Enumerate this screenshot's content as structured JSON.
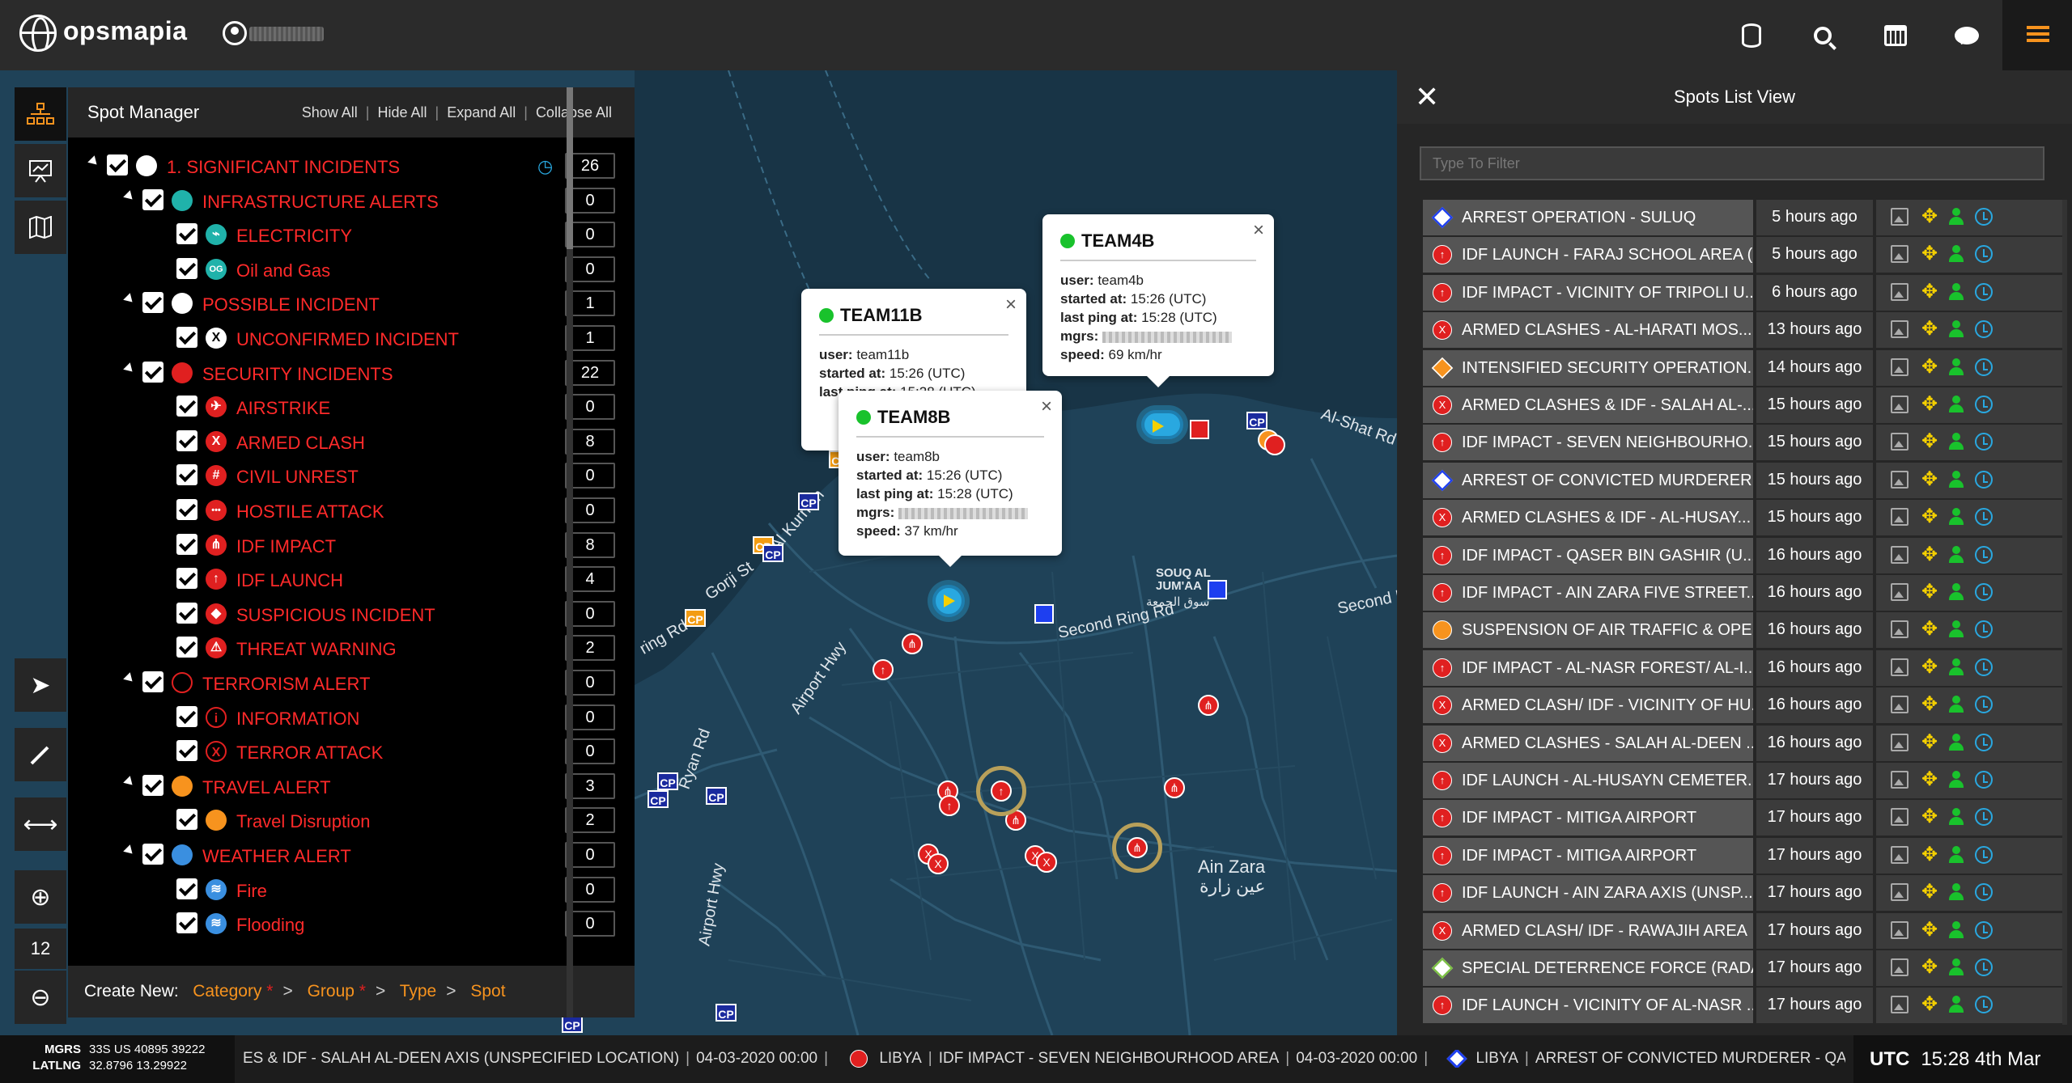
{
  "app": {
    "brand": "opsmapia"
  },
  "spot_manager": {
    "title": "Spot Manager",
    "links": [
      "Show All",
      "Hide All",
      "Expand All",
      "Collapse All"
    ],
    "tree": [
      {
        "level": 0,
        "label": "1. SIGNIFICANT INCIDENTS",
        "count": "26",
        "icon_color": "#ffffff",
        "icon": "",
        "timer": true
      },
      {
        "level": 1,
        "label": "INFRASTRUCTURE ALERTS",
        "count": "0",
        "icon_color": "#20b2aa",
        "icon": ""
      },
      {
        "level": 2,
        "label": "ELECTRICITY",
        "count": "0",
        "icon_color": "#20b2aa",
        "icon": "⌁"
      },
      {
        "level": 2,
        "label": "Oil and Gas",
        "count": "0",
        "icon_color": "#20b2aa",
        "icon": "OG"
      },
      {
        "level": 1,
        "label": "POSSIBLE INCIDENT",
        "count": "1",
        "icon_color": "#ffffff",
        "icon": ""
      },
      {
        "level": 2,
        "label": "UNCONFIRMED INCIDENT",
        "count": "1",
        "icon_color": "#ffffff",
        "icon": "X",
        "icon_text": "#000"
      },
      {
        "level": 1,
        "label": "SECURITY INCIDENTS",
        "count": "22",
        "icon_color": "#e02020",
        "icon": ""
      },
      {
        "level": 2,
        "label": "AIRSTRIKE",
        "count": "0",
        "icon_color": "#e02020",
        "icon": "✈"
      },
      {
        "level": 2,
        "label": "ARMED CLASH",
        "count": "8",
        "icon_color": "#e02020",
        "icon": "X"
      },
      {
        "level": 2,
        "label": "CIVIL UNREST",
        "count": "0",
        "icon_color": "#e02020",
        "icon": "#"
      },
      {
        "level": 2,
        "label": "HOSTILE ATTACK",
        "count": "0",
        "icon_color": "#e02020",
        "icon": "•••"
      },
      {
        "level": 2,
        "label": "IDF IMPACT",
        "count": "8",
        "icon_color": "#e02020",
        "icon": "⋔"
      },
      {
        "level": 2,
        "label": "IDF LAUNCH",
        "count": "4",
        "icon_color": "#e02020",
        "icon": "↑"
      },
      {
        "level": 2,
        "label": "SUSPICIOUS INCIDENT",
        "count": "0",
        "icon_color": "#e02020",
        "icon": "◆"
      },
      {
        "level": 2,
        "label": "THREAT WARNING",
        "count": "2",
        "icon_color": "#e02020",
        "icon": "⚠"
      },
      {
        "level": 1,
        "label": "TERRORISM ALERT",
        "count": "0",
        "icon_color": "#000000",
        "icon": "",
        "ring": "#e02020"
      },
      {
        "level": 2,
        "label": "INFORMATION",
        "count": "0",
        "icon_color": "#000000",
        "icon": "i",
        "ring": "#e02020",
        "icon_text": "#e02020"
      },
      {
        "level": 2,
        "label": "TERROR ATTACK",
        "count": "0",
        "icon_color": "#000000",
        "icon": "X",
        "ring": "#e02020",
        "icon_text": "#e02020"
      },
      {
        "level": 1,
        "label": "TRAVEL ALERT",
        "count": "3",
        "icon_color": "#f7931e",
        "icon": ""
      },
      {
        "level": 2,
        "label": "Travel Disruption",
        "count": "2",
        "icon_color": "#f7931e",
        "icon": ""
      },
      {
        "level": 1,
        "label": "WEATHER ALERT",
        "count": "0",
        "icon_color": "#3a8fe0",
        "icon": ""
      },
      {
        "level": 2,
        "label": "Fire",
        "count": "0",
        "icon_color": "#3a8fe0",
        "icon": "≋"
      },
      {
        "level": 2,
        "label": "Flooding",
        "count": "0",
        "icon_color": "#3a8fe0",
        "icon": "≋"
      }
    ],
    "footer": {
      "create_new": "Create New:",
      "crumbs": [
        "Category",
        "Group",
        "Type",
        "Spot"
      ]
    }
  },
  "tools": {
    "zoom_level": "12"
  },
  "popups": [
    {
      "id": "team11b",
      "title": "TEAM11B",
      "user": "team11b",
      "started": "15:26 (UTC)",
      "last_ping": "15:28 (UTC)"
    },
    {
      "id": "team8b",
      "title": "TEAM8B",
      "user": "team8b",
      "started": "15:26 (UTC)",
      "last_ping": "15:28 (UTC)",
      "speed": "37 km/hr"
    },
    {
      "id": "team4b",
      "title": "TEAM4B",
      "user": "team4b",
      "started": "15:26 (UTC)",
      "last_ping": "15:28 (UTC)",
      "speed": "69 km/hr"
    }
  ],
  "popup_labels": {
    "user": "user:",
    "started": "started at:",
    "last_ping": "last ping at:",
    "mgrs": "mgrs:",
    "speed": "speed:"
  },
  "map_labels": {
    "al_shat": "Al-Shat Rd",
    "souq": "SOUQ AL\nJUM'AA",
    "souq_ar": "سوق الجمعة",
    "second_ring": "Second Ring Rd",
    "second_ring2": "Second R",
    "airport_hwy": "Airport Hwy",
    "airport_hwy2": "Airport Hwy",
    "goiji": "Gorji St",
    "ain_zara": "Ain Zara",
    "ain_zara_ar": "عين زارة",
    "ring_rd": "ring Rd",
    "al_kurnish": "Al Kurnish",
    "ryan_rd": "Ryan Rd"
  },
  "spots_list": {
    "title": "Spots List View",
    "filter_placeholder": "Type To Filter",
    "rows": [
      {
        "name": "ARREST OPERATION - SULUQ",
        "time": "5 hours ago",
        "icon": "diamond-blue"
      },
      {
        "name": "IDF LAUNCH - FARAJ SCHOOL AREA (...",
        "time": "5 hours ago",
        "icon": "red"
      },
      {
        "name": "IDF IMPACT - VICINITY OF TRIPOLI U...",
        "time": "6 hours ago",
        "icon": "red"
      },
      {
        "name": "ARMED CLASHES - AL-HARATI MOS...",
        "time": "13 hours ago",
        "icon": "red-x"
      },
      {
        "name": "INTENSIFIED SECURITY OPERATION...",
        "time": "14 hours ago",
        "icon": "diamond-orange"
      },
      {
        "name": "ARMED CLASHES & IDF - SALAH AL-...",
        "time": "15 hours ago",
        "icon": "red-x"
      },
      {
        "name": "IDF IMPACT - SEVEN NEIGHBOURHO...",
        "time": "15 hours ago",
        "icon": "red"
      },
      {
        "name": "ARREST OF CONVICTED MURDERER ...",
        "time": "15 hours ago",
        "icon": "diamond-blue"
      },
      {
        "name": "ARMED CLASHES & IDF - AL-HUSAY...",
        "time": "15 hours ago",
        "icon": "red-x"
      },
      {
        "name": "IDF IMPACT - QASER BIN GASHIR (U...",
        "time": "16 hours ago",
        "icon": "red"
      },
      {
        "name": "IDF IMPACT - AIN ZARA FIVE STREET...",
        "time": "16 hours ago",
        "icon": "red"
      },
      {
        "name": "SUSPENSION OF AIR TRAFFIC & OPE...",
        "time": "16 hours ago",
        "icon": "orange"
      },
      {
        "name": "IDF IMPACT - AL-NASR FOREST/ AL-I...",
        "time": "16 hours ago",
        "icon": "red"
      },
      {
        "name": "ARMED CLASH/ IDF - VICINITY OF HU...",
        "time": "16 hours ago",
        "icon": "red-x"
      },
      {
        "name": "ARMED CLASHES - SALAH AL-DEEN ...",
        "time": "16 hours ago",
        "icon": "red-x"
      },
      {
        "name": "IDF LAUNCH - AL-HUSAYN CEMETER...",
        "time": "17 hours ago",
        "icon": "red"
      },
      {
        "name": "IDF IMPACT - MITIGA AIRPORT",
        "time": "17 hours ago",
        "icon": "red"
      },
      {
        "name": "IDF IMPACT - MITIGA AIRPORT",
        "time": "17 hours ago",
        "icon": "red"
      },
      {
        "name": "IDF LAUNCH - AIN ZARA AXIS (UNSP...",
        "time": "17 hours ago",
        "icon": "red"
      },
      {
        "name": "ARMED CLASH/ IDF - RAWAJIH AREA",
        "time": "17 hours ago",
        "icon": "red-x"
      },
      {
        "name": "SPECIAL DETERRENCE FORCE (RADA...",
        "time": "17 hours ago",
        "icon": "diamond-green"
      },
      {
        "name": "IDF LAUNCH - VICINITY OF AL-NASR ...",
        "time": "17 hours ago",
        "icon": "red"
      }
    ]
  },
  "bottom": {
    "mgrs_label": "MGRS",
    "mgrs_value": "33S US 40895 39222",
    "latlng_label": "LATLNG",
    "latlng_value": "32.8796 13.29922",
    "ticker_1": "ES & IDF - SALAH AL-DEEN AXIS (UNSPECIFIED LOCATION)",
    "ticker_1_date": "04-03-2020 00:00",
    "ticker_2_country": "LIBYA",
    "ticker_2": "IDF IMPACT - SEVEN NEIGHBOURHOOD AREA",
    "ticker_2_date": "04-03-2020 00:00",
    "ticker_3_country": "LIBYA",
    "ticker_3": "ARREST OF CONVICTED MURDERER - QAR YU",
    "utc_label": "UTC",
    "utc_value": "15:28 4th Mar"
  }
}
